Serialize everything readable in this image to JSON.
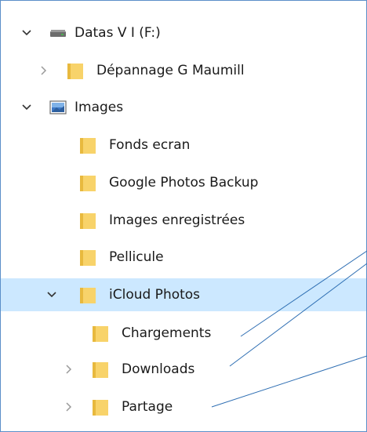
{
  "tree": {
    "drive": {
      "label": "Datas V I (F:)",
      "icon": "drive-icon",
      "expanded": true
    },
    "items": [
      {
        "label": "Dépannage G Maumill",
        "icon": "folder-icon",
        "expanded": false
      },
      {
        "label": "Images",
        "icon": "pictures-library-icon",
        "expanded": true
      },
      {
        "label": "Fonds ecran",
        "icon": "folder-icon"
      },
      {
        "label": "Google Photos Backup",
        "icon": "folder-icon"
      },
      {
        "label": "Images enregistrées",
        "icon": "folder-icon"
      },
      {
        "label": "Pellicule",
        "icon": "folder-icon"
      },
      {
        "label": "iCloud Photos",
        "icon": "folder-icon",
        "expanded": true,
        "selected": true
      },
      {
        "label": "Chargements",
        "icon": "folder-icon"
      },
      {
        "label": "Downloads",
        "icon": "folder-icon",
        "expanded": false
      },
      {
        "label": "Partage",
        "icon": "folder-icon",
        "expanded": false
      }
    ]
  },
  "colors": {
    "selection": "#cce8ff",
    "border": "#5b8fc9",
    "folder": "#f8d36a",
    "annotation_line": "#2f6fb3"
  }
}
